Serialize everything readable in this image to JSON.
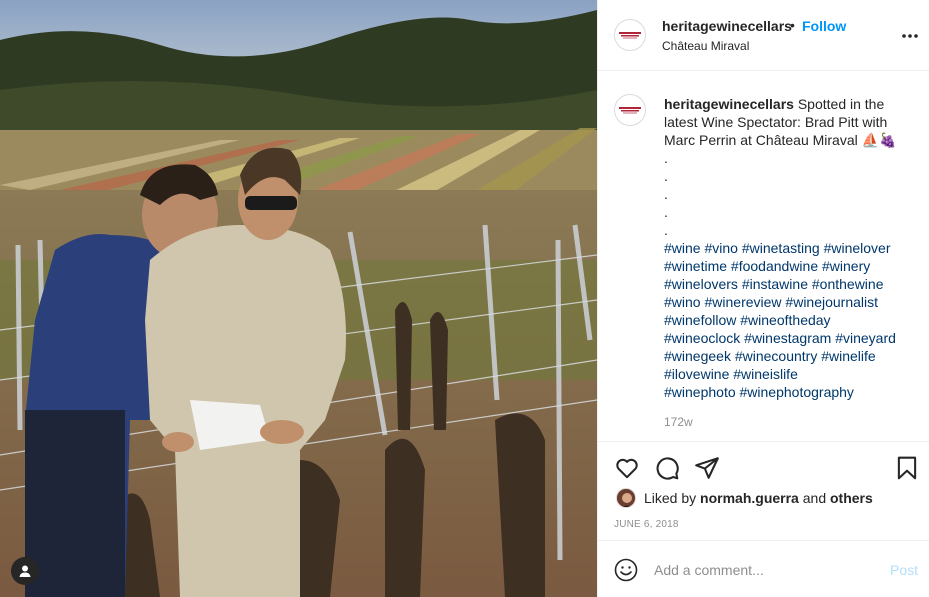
{
  "post": {
    "username": "heritagewinecellars",
    "location": "Château Miraval",
    "follow_label": "Follow",
    "dot": "•",
    "caption_text": "Spotted in the latest Wine Spectator: Brad Pitt with Marc Perrin at Château Miraval ⛵🍇",
    "caption_dots": [
      ".",
      ".",
      ".",
      ".",
      "."
    ],
    "hashtags": [
      "#wine",
      "#vino",
      "#winetasting",
      "#winelover",
      "#winetime",
      "#foodandwine",
      "#winery",
      "#winelovers",
      "#instawine",
      "#onthewine",
      "#wino",
      "#winereview",
      "#winejournalist",
      "#winefollow",
      "#wineoftheday",
      "#wineoclock",
      "#winestagram",
      "#vineyard",
      "#winegeek",
      "#winecountry",
      "#winelife",
      "#ilovewine",
      "#wineislife",
      "#winephoto",
      "#winephotography"
    ],
    "age": "172w",
    "liked_by_prefix": "Liked by",
    "liked_by_user": "normah.guerra",
    "liked_by_and": "and",
    "liked_by_others": "others",
    "date": "JUNE 6, 2018",
    "comment_placeholder": "Add a comment...",
    "post_label": "Post"
  },
  "icons": {
    "more": "more-options-icon",
    "like": "heart-icon",
    "comment": "comment-icon",
    "share": "paper-plane-icon",
    "save": "bookmark-icon",
    "emoji": "smiley-icon",
    "user_tag": "user-tag-icon"
  },
  "colors": {
    "follow": "#0095f6",
    "hashtag": "#00376b",
    "muted": "#8e8e8e",
    "post_disabled": "#b2dffc",
    "divider": "#efefef"
  }
}
